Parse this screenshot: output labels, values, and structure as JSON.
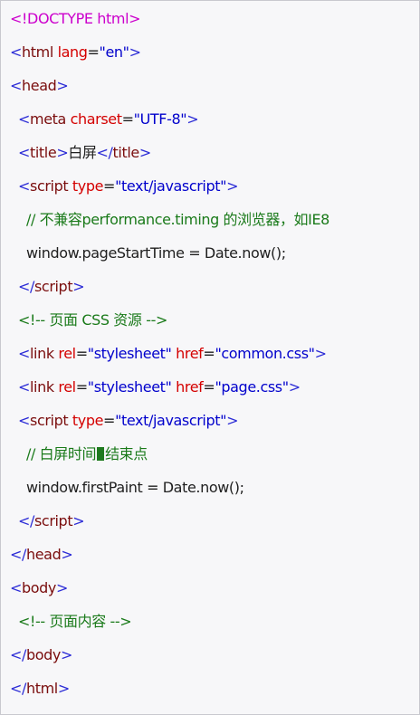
{
  "code_block": {
    "colors": {
      "doctype_bracket": "#cc00cc",
      "doctype_text": "#cc00cc",
      "tag": "#7a0d0d",
      "bracket": "#2b2bd6",
      "attr": "#d40000",
      "value": "#0000cc",
      "text": "#202020",
      "comment": "#1a7a1a",
      "caret": "#1f7a1f"
    },
    "lines": [
      {
        "indent": 0,
        "tokens": [
          {
            "t": "<!",
            "k": "doctype_bracket"
          },
          {
            "t": "DOCTYPE html",
            "k": "doctype_text"
          },
          {
            "t": ">",
            "k": "doctype_bracket"
          }
        ]
      },
      {
        "indent": 0,
        "tokens": [
          {
            "t": "<",
            "k": "bracket"
          },
          {
            "t": "html",
            "k": "tag"
          },
          {
            "t": " ",
            "k": "text"
          },
          {
            "t": "lang",
            "k": "attr"
          },
          {
            "t": "=",
            "k": "text"
          },
          {
            "t": "\"en\"",
            "k": "value"
          },
          {
            "t": ">",
            "k": "bracket"
          }
        ]
      },
      {
        "indent": 0,
        "tokens": [
          {
            "t": "<",
            "k": "bracket"
          },
          {
            "t": "head",
            "k": "tag"
          },
          {
            "t": ">",
            "k": "bracket"
          }
        ]
      },
      {
        "indent": 1,
        "tokens": [
          {
            "t": "<",
            "k": "bracket"
          },
          {
            "t": "meta",
            "k": "tag"
          },
          {
            "t": " ",
            "k": "text"
          },
          {
            "t": "charset",
            "k": "attr"
          },
          {
            "t": "=",
            "k": "text"
          },
          {
            "t": "\"UTF-8\"",
            "k": "value"
          },
          {
            "t": ">",
            "k": "bracket"
          }
        ]
      },
      {
        "indent": 1,
        "tokens": [
          {
            "t": "<",
            "k": "bracket"
          },
          {
            "t": "title",
            "k": "tag"
          },
          {
            "t": ">",
            "k": "bracket"
          },
          {
            "t": "白屏",
            "k": "text"
          },
          {
            "t": "</",
            "k": "bracket"
          },
          {
            "t": "title",
            "k": "tag"
          },
          {
            "t": ">",
            "k": "bracket"
          }
        ]
      },
      {
        "indent": 1,
        "tokens": [
          {
            "t": "<",
            "k": "bracket"
          },
          {
            "t": "script",
            "k": "tag"
          },
          {
            "t": " ",
            "k": "text"
          },
          {
            "t": "type",
            "k": "attr"
          },
          {
            "t": "=",
            "k": "text"
          },
          {
            "t": "\"text/javascript\"",
            "k": "value"
          },
          {
            "t": ">",
            "k": "bracket"
          }
        ]
      },
      {
        "indent": 2,
        "tokens": [
          {
            "t": "// 不兼容performance.timing 的浏览器，如IE8",
            "k": "comment"
          }
        ]
      },
      {
        "indent": 2,
        "tokens": [
          {
            "t": "window.pageStartTime = Date.now();",
            "k": "text"
          }
        ]
      },
      {
        "indent": 1,
        "tokens": [
          {
            "t": "</",
            "k": "bracket"
          },
          {
            "t": "script",
            "k": "tag"
          },
          {
            "t": ">",
            "k": "bracket"
          }
        ]
      },
      {
        "indent": 1,
        "tokens": [
          {
            "t": "<!-- 页面 CSS 资源 -->",
            "k": "comment"
          }
        ]
      },
      {
        "indent": 1,
        "tokens": [
          {
            "t": "<",
            "k": "bracket"
          },
          {
            "t": "link",
            "k": "tag"
          },
          {
            "t": " ",
            "k": "text"
          },
          {
            "t": "rel",
            "k": "attr"
          },
          {
            "t": "=",
            "k": "text"
          },
          {
            "t": "\"stylesheet\"",
            "k": "value"
          },
          {
            "t": " ",
            "k": "text"
          },
          {
            "t": "href",
            "k": "attr"
          },
          {
            "t": "=",
            "k": "text"
          },
          {
            "t": "\"common.css\"",
            "k": "value"
          },
          {
            "t": ">",
            "k": "bracket"
          }
        ]
      },
      {
        "indent": 1,
        "tokens": [
          {
            "t": "<",
            "k": "bracket"
          },
          {
            "t": "link",
            "k": "tag"
          },
          {
            "t": " ",
            "k": "text"
          },
          {
            "t": "rel",
            "k": "attr"
          },
          {
            "t": "=",
            "k": "text"
          },
          {
            "t": "\"stylesheet\"",
            "k": "value"
          },
          {
            "t": " ",
            "k": "text"
          },
          {
            "t": "href",
            "k": "attr"
          },
          {
            "t": "=",
            "k": "text"
          },
          {
            "t": "\"page.css\"",
            "k": "value"
          },
          {
            "t": ">",
            "k": "bracket"
          }
        ]
      },
      {
        "indent": 1,
        "tokens": [
          {
            "t": "<",
            "k": "bracket"
          },
          {
            "t": "script",
            "k": "tag"
          },
          {
            "t": " ",
            "k": "text"
          },
          {
            "t": "type",
            "k": "attr"
          },
          {
            "t": "=",
            "k": "text"
          },
          {
            "t": "\"text/javascript\"",
            "k": "value"
          },
          {
            "t": ">",
            "k": "bracket"
          }
        ]
      },
      {
        "indent": 2,
        "tokens": [
          {
            "t": "// 白屏时间",
            "k": "comment"
          },
          {
            "t": "",
            "k": "caret"
          },
          {
            "t": "结束点",
            "k": "comment"
          }
        ]
      },
      {
        "indent": 2,
        "tokens": [
          {
            "t": "window.firstPaint = Date.now();",
            "k": "text"
          }
        ]
      },
      {
        "indent": 1,
        "tokens": [
          {
            "t": "</",
            "k": "bracket"
          },
          {
            "t": "script",
            "k": "tag"
          },
          {
            "t": ">",
            "k": "bracket"
          }
        ]
      },
      {
        "indent": 0,
        "tokens": [
          {
            "t": "</",
            "k": "bracket"
          },
          {
            "t": "head",
            "k": "tag"
          },
          {
            "t": ">",
            "k": "bracket"
          }
        ]
      },
      {
        "indent": 0,
        "tokens": [
          {
            "t": "<",
            "k": "bracket"
          },
          {
            "t": "body",
            "k": "tag"
          },
          {
            "t": ">",
            "k": "bracket"
          }
        ]
      },
      {
        "indent": 1,
        "tokens": [
          {
            "t": "<!-- 页面内容 -->",
            "k": "comment"
          }
        ]
      },
      {
        "indent": 0,
        "tokens": [
          {
            "t": "</",
            "k": "bracket"
          },
          {
            "t": "body",
            "k": "tag"
          },
          {
            "t": ">",
            "k": "bracket"
          }
        ]
      },
      {
        "indent": 0,
        "tokens": [
          {
            "t": "</",
            "k": "bracket"
          },
          {
            "t": "html",
            "k": "tag"
          },
          {
            "t": ">",
            "k": "bracket"
          }
        ]
      }
    ]
  }
}
